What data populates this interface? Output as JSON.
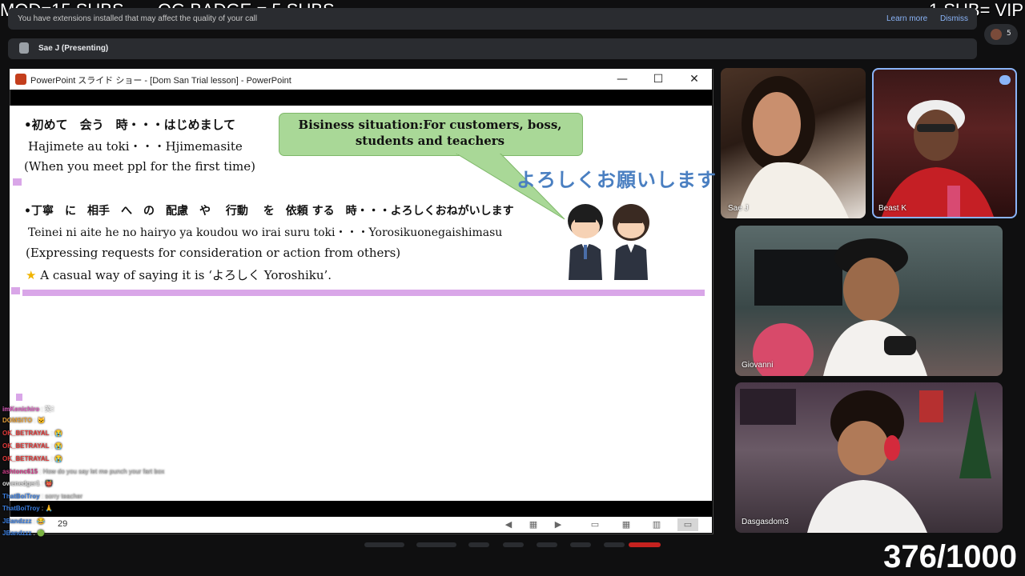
{
  "overlay": {
    "mod_text": "MOD=15 SUBS",
    "og_text": "OG BADGE = 5 SUBS",
    "vip_text": "1 SUB= VIP",
    "counter": "376/1000"
  },
  "banner": {
    "text": "You have extensions installed that may affect the quality of your call",
    "learn_more": "Learn more",
    "dismiss": "Dismiss"
  },
  "presenting": {
    "text": "Sae J (Presenting)"
  },
  "people": {
    "count": "5"
  },
  "ppt": {
    "title": "PowerPoint スライド ショー - [Dom San Trial lesson] - PowerPoint",
    "slide_counter": "29",
    "controls": [
      "◀",
      "▦",
      "▶",
      "▭",
      "▦",
      "▥",
      "▭"
    ]
  },
  "slide": {
    "line1": "•初めて　会う　時・・・はじめまして",
    "line2": "Hajimete  au  toki・・・Hjimemasite",
    "line3": "(When you meet ppl for the first time)",
    "line4": "•丁寧　に　相手　へ　の　配慮　や　 行動　 を　依頼 する　時・・・よろしくおねがいします",
    "line5": "Teinei ni  aite   he  no  hairyo ya koudou wo  irai  suru toki・・・Yorosikuonegaishimasu",
    "line6": "(Expressing requests for consideration or action from others)",
    "line7": "A casual way of saying it is ‘よろしく Yoroshiku’.",
    "bubble": "Bisiness situation:For customers, boss, students and teachers",
    "yoroshiku": "よろしくお願いします"
  },
  "participants": [
    {
      "name": "Sae J"
    },
    {
      "name": "Beast K"
    },
    {
      "name": "Giovanni"
    },
    {
      "name": "Dasgasdom3"
    }
  ],
  "chat": [
    {
      "user": "imKenichiro",
      "msg": "笑ﾐ",
      "color": "#e05cc1"
    },
    {
      "user": "DOMSITO",
      "msg": "🐱",
      "color": "#e8a23a"
    },
    {
      "user": "OK_BETRAYAL",
      "msg": "😭",
      "color": "#e33b3b"
    },
    {
      "user": "OK_BETRAYAL",
      "msg": "😭",
      "color": "#e33b3b"
    },
    {
      "user": "OK_BETRAYAL",
      "msg": "😭",
      "color": "#e33b3b"
    },
    {
      "user": "ashtonc615",
      "msg": "How do you say let me punch your fart box",
      "color": "#d23b8a"
    },
    {
      "user": "owenedger1",
      "msg": "👹",
      "color": "#d9d9d9"
    },
    {
      "user": "ThatBoiTroy",
      "msg": "sorry teacher",
      "color": "#3a7ee0"
    },
    {
      "user": "ThatBoiTroy",
      "msg": "🙏",
      "color": "#3a7ee0"
    },
    {
      "user": "JBandzzz",
      "msg": "😂",
      "color": "#3a7ee0"
    },
    {
      "user": "JBandzzz",
      "msg": "🟢",
      "color": "#3a7ee0"
    }
  ]
}
